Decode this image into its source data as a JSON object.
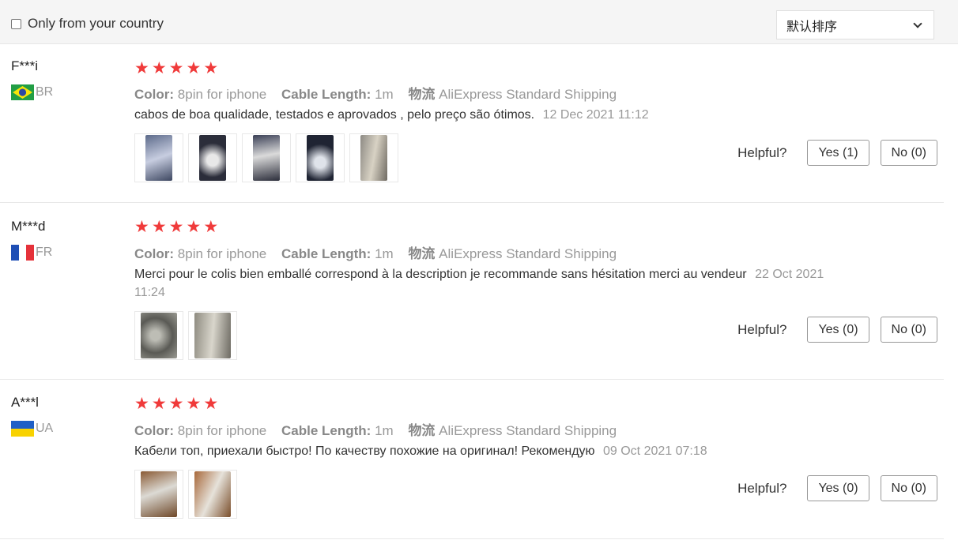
{
  "filter": {
    "label": "Only from your country",
    "checked": false
  },
  "sort": {
    "selected": "默认排序"
  },
  "helpful_label": "Helpful?",
  "attr_labels": {
    "color": "Color:",
    "length": "Cable Length:",
    "ship": "物流"
  },
  "reviews": [
    {
      "name": "F***i",
      "country": "BR",
      "stars": 5,
      "color": "8pin for iphone",
      "length": "1m",
      "shipping": "AliExpress Standard Shipping",
      "text": "cabos de boa qualidade, testados e aprovados , pelo preço são ótimos.",
      "date": "12 Dec 2021 11:12",
      "yes": "Yes (1)",
      "no": "No (0)",
      "photo_count": 5
    },
    {
      "name": "M***d",
      "country": "FR",
      "stars": 5,
      "color": "8pin for iphone",
      "length": "1m",
      "shipping": "AliExpress Standard Shipping",
      "text": "Merci pour le colis bien emballé correspond à la description je recommande sans hésitation merci au vendeur",
      "date": "22 Oct 2021 11:24",
      "yes": "Yes (0)",
      "no": "No (0)",
      "photo_count": 2
    },
    {
      "name": "A***l",
      "country": "UA",
      "stars": 5,
      "color": "8pin for iphone",
      "length": "1m",
      "shipping": "AliExpress Standard Shipping",
      "text": "Кабели топ, приехали быстро! По качеству похожие на оригинал! Рекомендую",
      "date": "09 Oct 2021 07:18",
      "yes": "Yes (0)",
      "no": "No (0)",
      "photo_count": 2
    }
  ],
  "colors": {
    "star": "#f03a3a",
    "muted": "#999999"
  }
}
